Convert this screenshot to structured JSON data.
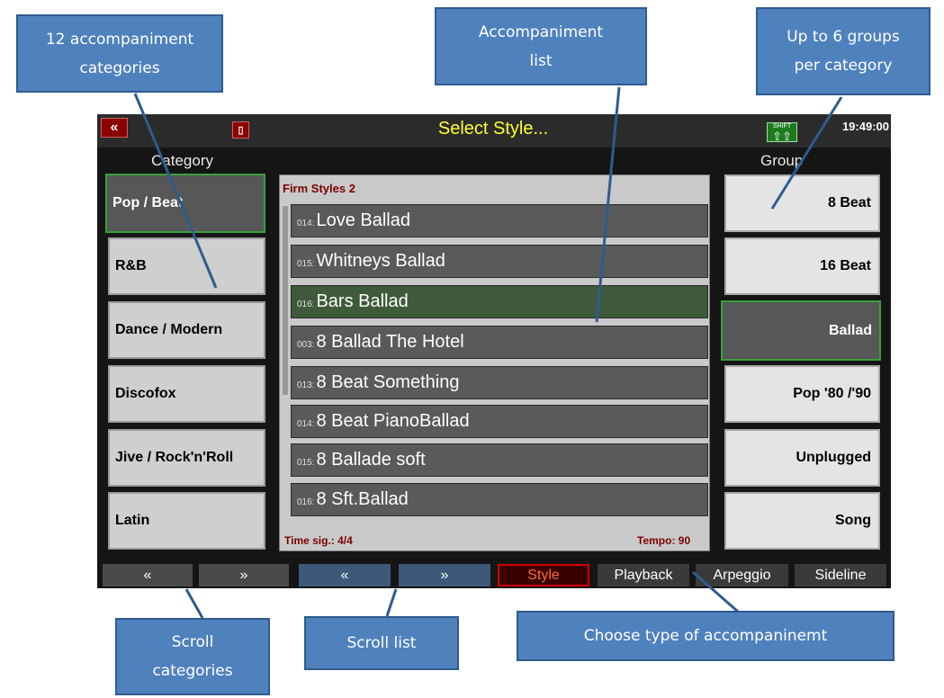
{
  "callouts": {
    "categories": [
      "12 accompaniment",
      "categories"
    ],
    "list": [
      "Accompaniment",
      "list"
    ],
    "groups": [
      "Up to 6 groups",
      "per  category"
    ],
    "scroll_categories": [
      "Scroll",
      "categories"
    ],
    "scroll_list": "Scroll list",
    "choose_type": "Choose type of accompaninemt"
  },
  "screen": {
    "title": "Select Style...",
    "clock": "19:49:00",
    "shift_label": "SHIFT",
    "category_header": "Category",
    "group_header": "Group",
    "categories": [
      {
        "label": "Pop / Beat",
        "selected": true
      },
      {
        "label": "R&B"
      },
      {
        "label": "Dance / Modern"
      },
      {
        "label": "Discofox"
      },
      {
        "label": "Jive / Rock'n'Roll"
      },
      {
        "label": "Latin"
      }
    ],
    "list_title": "Firm Styles 2",
    "styles": [
      {
        "num": "014:",
        "name": "Love Ballad"
      },
      {
        "num": "015:",
        "name": "Whitneys Ballad"
      },
      {
        "num": "016:",
        "name": "Bars Ballad",
        "selected": true
      },
      {
        "num": "003:",
        "name": "8 Ballad The Hotel"
      },
      {
        "num": "013:",
        "name": "8 Beat Something"
      },
      {
        "num": "014:",
        "name": "8 Beat PianoBallad"
      },
      {
        "num": "015:",
        "name": "8 Ballade soft"
      },
      {
        "num": "016:",
        "name": "8 Sft.Ballad"
      }
    ],
    "time_sig": "Time sig.: 4/4",
    "tempo": "Tempo: 90",
    "groups": [
      {
        "label": "8  Beat"
      },
      {
        "label": "16  Beat"
      },
      {
        "label": "Ballad",
        "selected": true
      },
      {
        "label": "Pop  '80 /'90"
      },
      {
        "label": "Unplugged"
      },
      {
        "label": "Song"
      }
    ],
    "bottom": {
      "up1": "«",
      "down1": "»",
      "up2": "«",
      "down2": "»",
      "style": "Style",
      "playback": "Playback",
      "arpeggio": "Arpeggio",
      "sideline": "Sideline"
    }
  },
  "colors": {
    "callout": "#4f81bd",
    "title": "#ffff33",
    "selected_border": "#3aa03a",
    "style_active": "#ff6a3a"
  }
}
